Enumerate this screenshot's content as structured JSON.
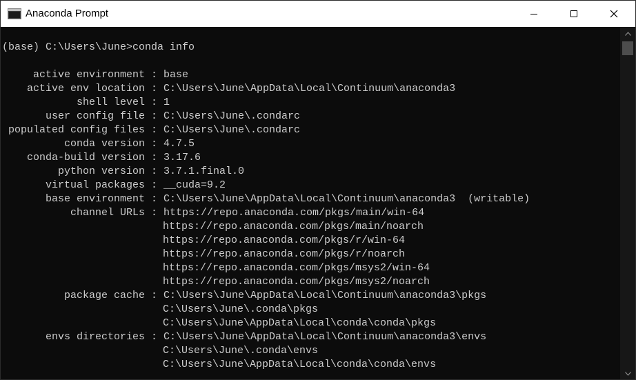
{
  "window": {
    "title": "Anaconda Prompt"
  },
  "console": {
    "prompt": "(base) C:\\Users\\June>conda info",
    "entries": [
      {
        "key": "active environment",
        "value": "base",
        "cont": []
      },
      {
        "key": "active env location",
        "value": "C:\\Users\\June\\AppData\\Local\\Continuum\\anaconda3",
        "cont": []
      },
      {
        "key": "shell level",
        "value": "1",
        "cont": []
      },
      {
        "key": "user config file",
        "value": "C:\\Users\\June\\.condarc",
        "cont": []
      },
      {
        "key": "populated config files",
        "value": "C:\\Users\\June\\.condarc",
        "cont": []
      },
      {
        "key": "conda version",
        "value": "4.7.5",
        "cont": []
      },
      {
        "key": "conda-build version",
        "value": "3.17.6",
        "cont": []
      },
      {
        "key": "python version",
        "value": "3.7.1.final.0",
        "cont": []
      },
      {
        "key": "virtual packages",
        "value": "__cuda=9.2",
        "cont": []
      },
      {
        "key": "base environment",
        "value": "C:\\Users\\June\\AppData\\Local\\Continuum\\anaconda3  (writable)",
        "cont": []
      },
      {
        "key": "channel URLs",
        "value": "https://repo.anaconda.com/pkgs/main/win-64",
        "cont": [
          "https://repo.anaconda.com/pkgs/main/noarch",
          "https://repo.anaconda.com/pkgs/r/win-64",
          "https://repo.anaconda.com/pkgs/r/noarch",
          "https://repo.anaconda.com/pkgs/msys2/win-64",
          "https://repo.anaconda.com/pkgs/msys2/noarch"
        ]
      },
      {
        "key": "package cache",
        "value": "C:\\Users\\June\\AppData\\Local\\Continuum\\anaconda3\\pkgs",
        "cont": [
          "C:\\Users\\June\\.conda\\pkgs",
          "C:\\Users\\June\\AppData\\Local\\conda\\conda\\pkgs"
        ]
      },
      {
        "key": "envs directories",
        "value": "C:\\Users\\June\\AppData\\Local\\Continuum\\anaconda3\\envs",
        "cont": [
          "C:\\Users\\June\\.conda\\envs",
          "C:\\Users\\June\\AppData\\Local\\conda\\conda\\envs"
        ]
      }
    ]
  },
  "icons": {
    "app": "terminal-icon",
    "minimize": "minimize-icon",
    "maximize": "maximize-icon",
    "close": "close-icon",
    "scroll_up": "scroll-up-arrow-icon",
    "scroll_down": "scroll-down-arrow-icon"
  },
  "colors": {
    "console_bg": "#0c0c0c",
    "console_text": "#cccccc",
    "titlebar_bg": "#ffffff"
  }
}
